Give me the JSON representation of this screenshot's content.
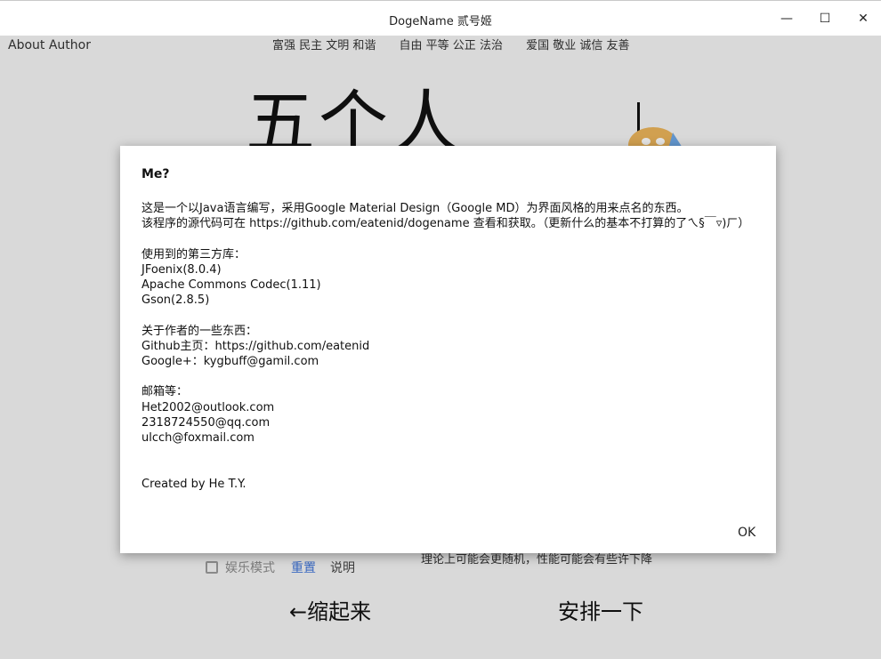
{
  "window": {
    "title": "DogeName 贰号姬",
    "minimize_glyph": "—",
    "maximize_glyph": "☐",
    "close_glyph": "✕"
  },
  "app": {
    "about_author": "About Author",
    "values": [
      "富强 民主 文明 和谐",
      "自由 平等 公正 法治",
      "爱国 敬业 诚信 友善"
    ],
    "big_title": "五个人",
    "entertainment_mode": "娱乐模式",
    "reset": "重置",
    "explain": "说明",
    "note": "理论上可能会更随机，性能可能会有些许下降",
    "collapse": "←缩起来",
    "arrange": "安排一下"
  },
  "dialog": {
    "heading": "Me?",
    "body_lines": [
      "这是一个以Java语言编写，采用Google Material Design（Google MD）为界面风格的用来点名的东西。",
      "该程序的源代码可在 https://github.com/eatenid/dogename 查看和获取。（更新什么的基本不打算的了ㄟ§￣▿)ㄏ）",
      "",
      "使用到的第三方库：",
      "JFoenix(8.0.4)",
      "Apache Commons Codec(1.11)",
      "Gson(2.8.5)",
      "",
      "关于作者的一些东西：",
      "Github主页：https://github.com/eatenid",
      "Google+：kygbuff@gamil.com",
      "",
      "邮箱等：",
      "Het2002@outlook.com",
      "2318724550@qq.com",
      "ulcch@foxmail.com",
      "",
      "",
      "Created by He T.Y."
    ],
    "ok_label": "OK"
  },
  "colors": {
    "link_blue": "#3f73d6",
    "overlay": "rgba(0,0,0,0.1)"
  }
}
